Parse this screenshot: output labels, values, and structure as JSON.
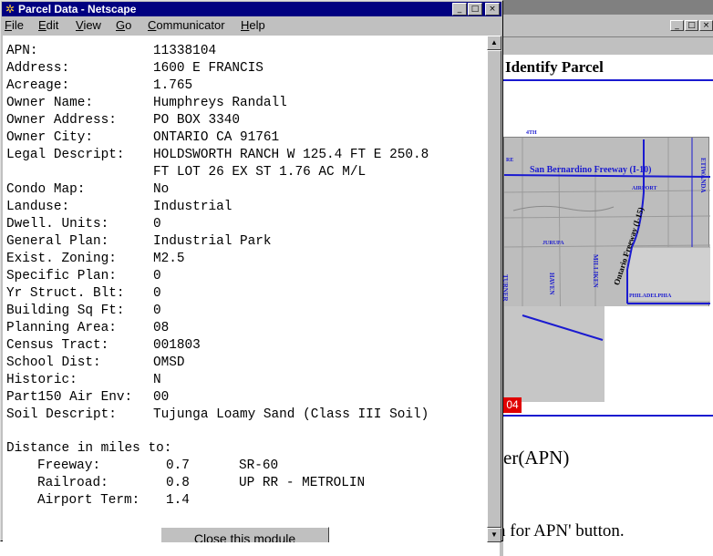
{
  "popup": {
    "title": "Parcel Data - Netscape",
    "menu": [
      "File",
      "Edit",
      "View",
      "Go",
      "Communicator",
      "Help"
    ],
    "menu_mnemonic": [
      "F",
      "E",
      "V",
      "G",
      "C",
      "H"
    ],
    "fields": [
      {
        "label": "APN:",
        "value": "11338104"
      },
      {
        "label": "Address:",
        "value": "1600 E FRANCIS"
      },
      {
        "label": "Acreage:",
        "value": "1.765"
      },
      {
        "label": "Owner Name:",
        "value": "Humphreys Randall"
      },
      {
        "label": "Owner Address:",
        "value": "PO BOX 3340"
      },
      {
        "label": "Owner City:",
        "value": "ONTARIO CA 91761"
      },
      {
        "label": "Legal Descript:",
        "value": "HOLDSWORTH RANCH W 125.4 FT E 250.8",
        "value2": "FT LOT 26 EX ST 1.76 AC M/L"
      },
      {
        "label": "Condo Map:",
        "value": "No"
      },
      {
        "label": "Landuse:",
        "value": "Industrial"
      },
      {
        "label": "Dwell. Units:",
        "value": "0"
      },
      {
        "label": "General Plan:",
        "value": "Industrial Park"
      },
      {
        "label": "Exist. Zoning:",
        "value": "M2.5"
      },
      {
        "label": "Specific Plan:",
        "value": "0"
      },
      {
        "label": "Yr Struct. Blt:",
        "value": "0"
      },
      {
        "label": "Building Sq Ft:",
        "value": "0"
      },
      {
        "label": "Planning Area:",
        "value": "08"
      },
      {
        "label": "Census Tract:",
        "value": "001803"
      },
      {
        "label": "School Dist:",
        "value": "OMSD"
      },
      {
        "label": "Historic:",
        "value": "N"
      },
      {
        "label": "Part150 Air Env:",
        "value": "00"
      },
      {
        "label": "Soil Descript:",
        "value": "Tujunga Loamy Sand (Class III Soil)"
      }
    ],
    "distance_heading": "Distance in miles to:",
    "distances": [
      {
        "label": "Freeway:",
        "miles": "0.7",
        "name": "SR-60"
      },
      {
        "label": "Railroad:",
        "miles": "0.8",
        "name": "UP RR - METROLIN"
      },
      {
        "label": "Airport Term:",
        "miles": "1.4",
        "name": ""
      }
    ],
    "close_button": "Close this module"
  },
  "background": {
    "heading": "Identify Parcel",
    "map_labels": {
      "freeway_10": "San Bernardino Freeway (I-10)",
      "freeway_15": "Ontario Freeway (I-15)",
      "airport": "AIRPORT",
      "jurupa": "JURUPA",
      "philadelphia": "PHILADELPHIA",
      "turner": "TURNER",
      "haven": "HAVEN",
      "milliken": "MILLIKEN",
      "etiwanda": "ETIWANDA",
      "fourth": "4TH",
      "top_left": "RE"
    },
    "marker": "04",
    "text_apn": "er(APN)",
    "text_button": "n for APN' button."
  },
  "colors": {
    "titlebar": "#000080",
    "window": "#c0c0c0",
    "map_road": "#1a1ad0",
    "marker": "#e00000"
  }
}
